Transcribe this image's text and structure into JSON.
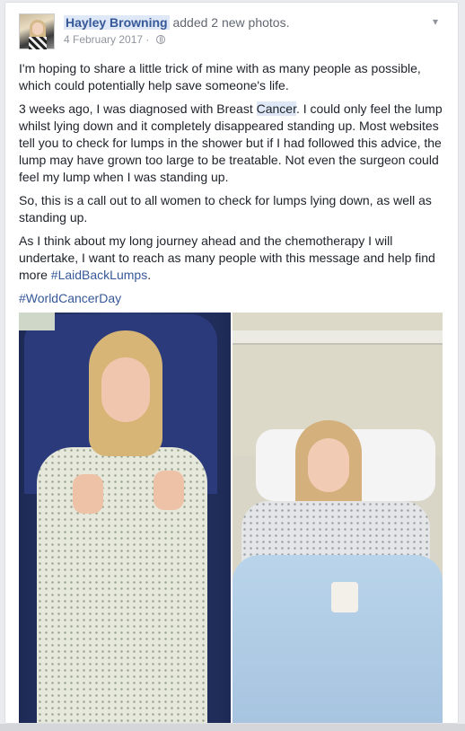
{
  "post": {
    "author": "Hayley Browning",
    "action": "added 2 new photos.",
    "date": "4 February 2017",
    "paragraphs": {
      "p1": "I'm hoping to share a little trick of mine with as many people as possible, which could potentially help save someone's life.",
      "p2_before": "3 weeks ago, I was diagnosed with Breast ",
      "p2_highlight": "Cancer",
      "p2_after": ". I could only feel the lump whilst lying down and it completely disappeared standing up. Most websites tell you to check for lumps in the shower but if I had followed this advice, the lump may have grown too large to be treatable. Not even the surgeon could feel my lump when I was standing up.",
      "p3": "So, this is a call out to all women to check for lumps lying down, as well as standing up.",
      "p4": "As I think about my long journey ahead and the chemotherapy I will undertake, I want to reach as many people with this message and help find more ",
      "p4_tag": "#LaidBackLumps",
      "p4_end": ".",
      "p5_tag": "#WorldCancerDay"
    }
  },
  "icons": {
    "privacy": "globe-icon",
    "menu": "chevron-down-icon"
  },
  "colors": {
    "link": "#365899",
    "text": "#1d2129",
    "meta": "#90949c",
    "highlight": "#dfe8f6"
  }
}
